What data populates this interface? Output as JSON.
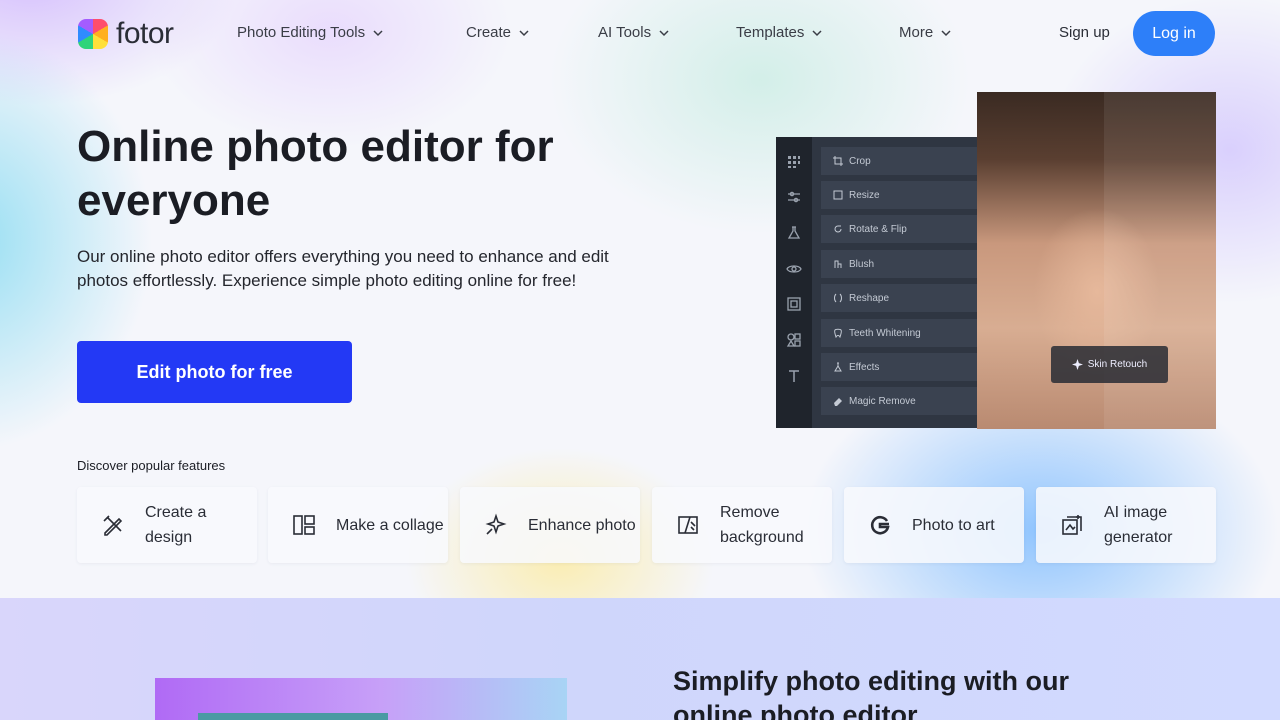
{
  "brand": {
    "name": "fotor"
  },
  "nav": {
    "items": [
      "Photo Editing Tools",
      "Create",
      "AI Tools",
      "Templates",
      "More"
    ],
    "signup": "Sign up",
    "login": "Log in"
  },
  "hero": {
    "title": "Online photo editor for everyone",
    "description": "Our online photo editor offers everything you need to enhance and edit photos effortlessly. Experience simple photo editing online for free!",
    "cta": "Edit photo for free"
  },
  "editor_preview": {
    "menu": [
      "Crop",
      "Resize",
      "Rotate & Flip",
      "Blush",
      "Reshape",
      "Teeth Whitening",
      "Effects",
      "Magic Remove"
    ],
    "badge": "Skin Retouch"
  },
  "features": {
    "heading": "Discover popular features",
    "items": [
      {
        "label": "Create a design",
        "icon": "pen-ruler-icon"
      },
      {
        "label": "Make a collage",
        "icon": "collage-icon"
      },
      {
        "label": "Enhance photo",
        "icon": "sparkle-icon"
      },
      {
        "label": "Remove background",
        "icon": "remove-bg-icon"
      },
      {
        "label": "Photo to art",
        "icon": "art-g-icon"
      },
      {
        "label": "AI image generator",
        "icon": "ai-generator-icon"
      }
    ]
  },
  "section2": {
    "title": "Simplify photo editing with our online photo editor"
  },
  "colors": {
    "login": "#2d7ff9",
    "cta": "#2339f5",
    "text": "#1b1d24"
  }
}
